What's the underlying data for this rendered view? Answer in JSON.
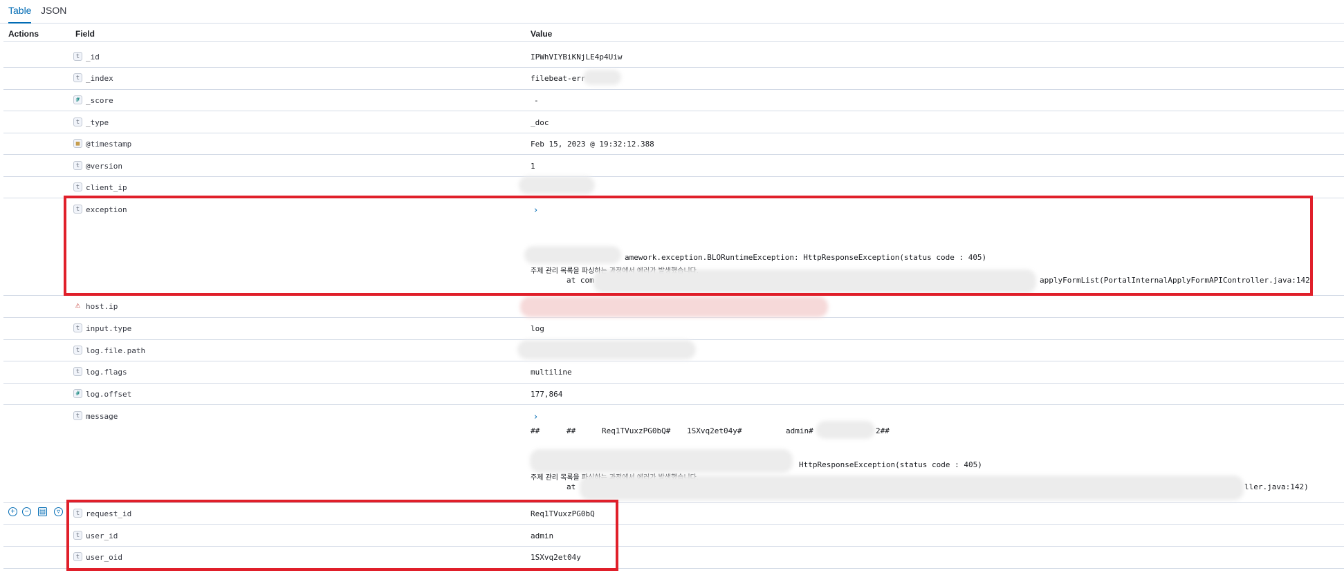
{
  "tabs": [
    {
      "label": "Table",
      "active": true
    },
    {
      "label": "JSON",
      "active": false
    }
  ],
  "headers": {
    "actions": "Actions",
    "field": "Field",
    "value": "Value"
  },
  "rows": [
    {
      "field": "_id",
      "type": "t",
      "value": "IPWhVIYBiKNjLE4p4Uiw"
    },
    {
      "field": "_index",
      "type": "t",
      "value": "filebeat-err"
    },
    {
      "field": "_score",
      "type": "#",
      "value": "-"
    },
    {
      "field": "_type",
      "type": "t",
      "value": "_doc"
    },
    {
      "field": "@timestamp",
      "type": "date",
      "value": "Feb 15, 2023 @ 19:32:12.388"
    },
    {
      "field": "@version",
      "type": "t",
      "value": "1"
    },
    {
      "field": "client_ip",
      "type": "t",
      "value": ""
    },
    {
      "field": "exception",
      "type": "t",
      "value_lines": [
        "amework.exception.BLORuntimeException: HttpResponseException(status code : 405)",
        "주제 관리 목록을 파싱하는 과정에서 에러가 발생했습니다.",
        "at com",
        "applyFormList(PortalInternalApplyFormAPIController.java:142)"
      ]
    },
    {
      "field": "host.ip",
      "type": "warn",
      "value": ""
    },
    {
      "field": "input.type",
      "type": "t",
      "value": "log"
    },
    {
      "field": "log.file.path",
      "type": "t",
      "value": ""
    },
    {
      "field": "log.flags",
      "type": "t",
      "value": "multiline"
    },
    {
      "field": "log.offset",
      "type": "#",
      "value": "177,864"
    },
    {
      "field": "message",
      "type": "t",
      "value_lines": [
        "##",
        "##",
        "Req1TVuxzPG0bQ#",
        "1SXvq2et04y#",
        "admin#",
        "2##",
        "HttpResponseException(status code : 405)",
        "주제 관리 목록을 파싱하는 과정에서 에러가 발생했습니다.",
        "at",
        "ller.java:142)"
      ]
    },
    {
      "field": "request_id",
      "type": "t",
      "value": "Req1TVuxzPG0bQ"
    },
    {
      "field": "user_id",
      "type": "t",
      "value": "admin"
    },
    {
      "field": "user_oid",
      "type": "t",
      "value": "1SXvq2et04y"
    }
  ],
  "icons": {
    "expand": "chevron-right-icon",
    "filter_for": "magnify-plus-icon",
    "filter_out": "magnify-minus-icon",
    "toggle_column": "table-column-icon",
    "filter_exists": "filter-icon"
  },
  "colors": {
    "accent": "#006bb4",
    "highlight_box": "#e01f2a"
  }
}
